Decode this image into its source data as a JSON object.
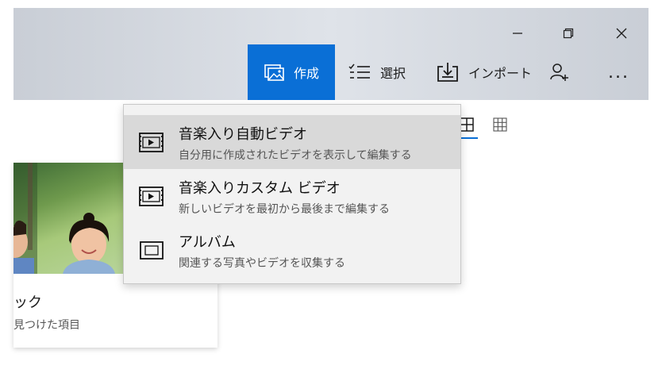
{
  "window": {
    "controls": [
      {
        "name": "minimize-button",
        "icon": "minimize-icon"
      },
      {
        "name": "restore-button",
        "icon": "restore-icon"
      },
      {
        "name": "close-button",
        "icon": "close-icon"
      }
    ]
  },
  "toolbar": {
    "create_label": "作成",
    "select_label": "選択",
    "import_label": "インポート",
    "more_label": "..."
  },
  "menu": {
    "items": [
      {
        "title": "音楽入り自動ビデオ",
        "subtitle": "自分用に作成されたビデオを表示して編集する",
        "icon": "video-icon",
        "highlighted": true
      },
      {
        "title": "音楽入りカスタム ビデオ",
        "subtitle": "新しいビデオを最初から最後まで編集する",
        "icon": "video-icon",
        "highlighted": false
      },
      {
        "title": "アルバム",
        "subtitle": "関連する写真やビデオを収集する",
        "icon": "album-icon",
        "highlighted": false
      }
    ]
  },
  "card": {
    "title": "ック",
    "subtitle": "見つけた項目"
  },
  "colors": {
    "accent": "#0a6fd6",
    "titlebar": "#d3d8df",
    "menu_bg": "#f2f2f2",
    "menu_highlight": "#d9d9d9"
  }
}
